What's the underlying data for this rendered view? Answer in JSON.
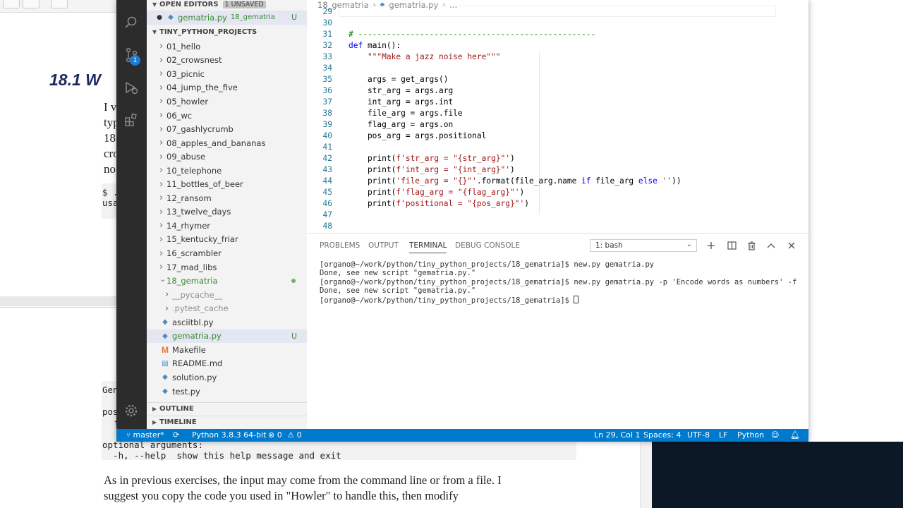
{
  "book": {
    "section_heading": "18.1  W",
    "body_fragments": [
      "I v",
      "typ",
      "18",
      "cro",
      "no"
    ],
    "code_fragments": [
      "$ .",
      "usa"
    ],
    "help_fragments": [
      "Gen",
      "pos",
      "t"
    ],
    "help_optional": "optional arguments:",
    "help_line": "  -h, --help  show this help message and exit",
    "paragraph_line1": "As in previous exercises, the input may come from the command line or from a file. I",
    "paragraph_line2": "suggest you copy the code you used in \"Howler\" to handle this, then modify"
  },
  "sidebar": {
    "open_editors": {
      "title": "OPEN EDITORS",
      "badge": "1 UNSAVED",
      "file": "gematria.py",
      "folder": "18_gematria",
      "status": "U"
    },
    "project": {
      "title": "TINY_PYTHON_PROJECTS",
      "folders": [
        "01_hello",
        "02_crowsnest",
        "03_picnic",
        "04_jump_the_five",
        "05_howler",
        "06_wc",
        "07_gashlycrumb",
        "08_apples_and_bananas",
        "09_abuse",
        "10_telephone",
        "11_bottles_of_beer",
        "12_ransom",
        "13_twelve_days",
        "14_rhymer",
        "15_kentucky_friar",
        "16_scrambler",
        "17_mad_libs"
      ],
      "open_folder": "18_gematria",
      "subfolders": [
        "__pycache__",
        ".pytest_cache"
      ],
      "files": [
        {
          "name": "asciitbl.py",
          "icon": "python-icon"
        },
        {
          "name": "gematria.py",
          "icon": "python-icon",
          "status": "U"
        },
        {
          "name": "Makefile",
          "icon": "makefile-icon"
        },
        {
          "name": "README.md",
          "icon": "markdown-icon"
        },
        {
          "name": "solution.py",
          "icon": "python-icon"
        },
        {
          "name": "test.py",
          "icon": "python-icon"
        }
      ]
    },
    "outline": "OUTLINE",
    "timeline": "TIMELINE"
  },
  "activity": {
    "scm_badge": "1",
    "icons": [
      "search-icon",
      "source-control-icon",
      "debug-icon",
      "extensions-icon",
      "settings-gear-icon"
    ]
  },
  "editor": {
    "breadcrumb": [
      "18_gematria",
      "gematria.py",
      "..."
    ],
    "line_numbers": [
      "29",
      "30",
      "31",
      "32",
      "33",
      "34",
      "35",
      "36",
      "37",
      "38",
      "39",
      "40",
      "41",
      "42",
      "43",
      "44",
      "45",
      "46",
      "47",
      "48"
    ],
    "lines": {
      "l31": "# --------------------------------------------------",
      "l32_kw": "def",
      "l32_rest": " main():",
      "l33": "    \"\"\"Make a jazz noise here\"\"\"",
      "l35": "    args = get_args()",
      "l36": "    str_arg = args.arg",
      "l37": "    int_arg = args.int",
      "l38": "    file_arg = args.file",
      "l39": "    flag_arg = args.on",
      "l40": "    pos_arg = args.positional",
      "l42_a": "    print(",
      "l42_b": "f'str_arg = \"{str_arg}\"'",
      "l42_c": ")",
      "l43_a": "    print(",
      "l43_b": "f'int_arg = \"{int_arg}\"'",
      "l43_c": ")",
      "l44_a": "    print(",
      "l44_b": "'file_arg = \"{}\"'",
      "l44_c": ".format(file_arg.name ",
      "l44_d": "if",
      "l44_e": " file_arg ",
      "l44_f": "else",
      "l44_g": " ",
      "l44_h": "''",
      "l44_i": "))",
      "l45_a": "    print(",
      "l45_b": "f'flag_arg = \"{flag_arg}\"'",
      "l45_c": ")",
      "l46_a": "    print(",
      "l46_b": "f'positional = \"{pos_arg}\"'",
      "l46_c": ")"
    }
  },
  "panel": {
    "tabs": [
      "PROBLEMS",
      "OUTPUT",
      "TERMINAL",
      "DEBUG CONSOLE"
    ],
    "active_tab": "TERMINAL",
    "terminal_select": "1: bash",
    "terminal_lines": [
      "[organo@~/work/python/tiny_python_projects/18_gematria]$ new.py gematria.py",
      "Done, see new script \"gematria.py.\"",
      "[organo@~/work/python/tiny_python_projects/18_gematria]$ new.py gematria.py -p 'Encode words as numbers' -f",
      "Done, see new script \"gematria.py.\"",
      "[organo@~/work/python/tiny_python_projects/18_gematria]$ "
    ]
  },
  "statusbar": {
    "branch": "master*",
    "interpreter": "Python 3.8.3 64-bit",
    "errors": "0",
    "warnings": "0",
    "cursor": "Ln 29, Col 1",
    "spaces": "Spaces: 4",
    "encoding": "UTF-8",
    "eol": "LF",
    "language": "Python"
  },
  "colors": {
    "statusbar": "#007acc",
    "activity_bar": "#2c2c2c",
    "sidebar": "#f3f3f3",
    "modified_green": "#388a34"
  }
}
